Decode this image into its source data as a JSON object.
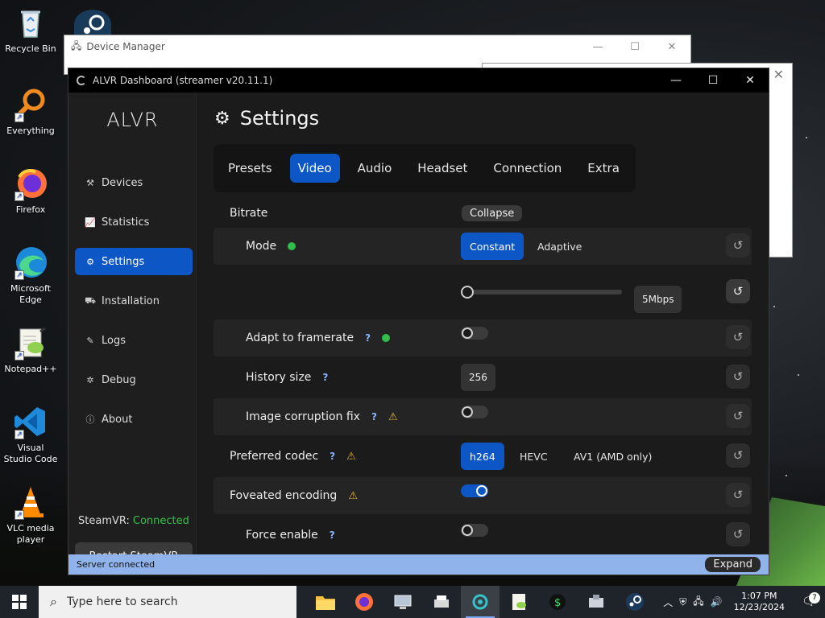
{
  "desktop": {
    "icons": [
      {
        "label": "Recycle Bin",
        "name": "recycle-bin"
      },
      {
        "label": "Everything",
        "name": "everything"
      },
      {
        "label": "Firefox",
        "name": "firefox"
      },
      {
        "label": "Microsoft Edge",
        "name": "microsoft-edge"
      },
      {
        "label": "Notepad++",
        "name": "notepad-plus-plus"
      },
      {
        "label": "Visual Studio Code",
        "name": "visual-studio-code"
      },
      {
        "label": "VLC media player",
        "name": "vlc-media-player"
      }
    ]
  },
  "background_windows": {
    "device_manager_title": "Device Manager"
  },
  "window": {
    "title": "ALVR Dashboard (streamer v20.11.1)"
  },
  "sidebar": {
    "brand": "ALVR",
    "items": [
      {
        "label": "Devices",
        "icon": "devices-icon"
      },
      {
        "label": "Statistics",
        "icon": "chart-icon"
      },
      {
        "label": "Settings",
        "icon": "gear-icon",
        "active": true
      },
      {
        "label": "Installation",
        "icon": "install-icon"
      },
      {
        "label": "Logs",
        "icon": "logs-icon"
      },
      {
        "label": "Debug",
        "icon": "debug-icon"
      },
      {
        "label": "About",
        "icon": "info-icon"
      }
    ],
    "steamvr_label": "SteamVR:",
    "steamvr_status": "Connected",
    "restart_label": "Restart SteamVR"
  },
  "main": {
    "title": "Settings",
    "tabs": [
      {
        "label": "Presets"
      },
      {
        "label": "Video",
        "active": true
      },
      {
        "label": "Audio"
      },
      {
        "label": "Headset"
      },
      {
        "label": "Connection"
      },
      {
        "label": "Extra"
      }
    ],
    "bitrate": {
      "label": "Bitrate",
      "collapse_label": "Collapse",
      "mode_label": "Mode",
      "mode_options": [
        "Constant",
        "Adaptive"
      ],
      "mode_selected": "Constant",
      "slider_value_label": "5Mbps",
      "slider_fraction": 0.0,
      "adapt_framerate_label": "Adapt to framerate",
      "adapt_framerate_on": false,
      "history_size_label": "History size",
      "history_size_value": "256",
      "image_corruption_label": "Image corruption fix",
      "image_corruption_on": false
    },
    "codec": {
      "label": "Preferred codec",
      "options": [
        "h264",
        "HEVC",
        "AV1 (AMD only)"
      ],
      "selected": "h264"
    },
    "foveated": {
      "label": "Foveated encoding",
      "on": true,
      "force_enable_label": "Force enable",
      "force_enable_on": false
    },
    "help_glyph": "?",
    "warning_glyph": "⚠"
  },
  "statusbar": {
    "text": "Server connected",
    "expand_label": "Expand"
  },
  "taskbar": {
    "search_placeholder": "Type here to search",
    "time": "1:07 PM",
    "date": "12/23/2024",
    "notification_count": "7"
  },
  "colors": {
    "accent": "#0d56c5",
    "connected": "#38c04a",
    "warning": "#e2b437",
    "help": "#8ab4ff",
    "statusbar": "#8fb3ea"
  }
}
